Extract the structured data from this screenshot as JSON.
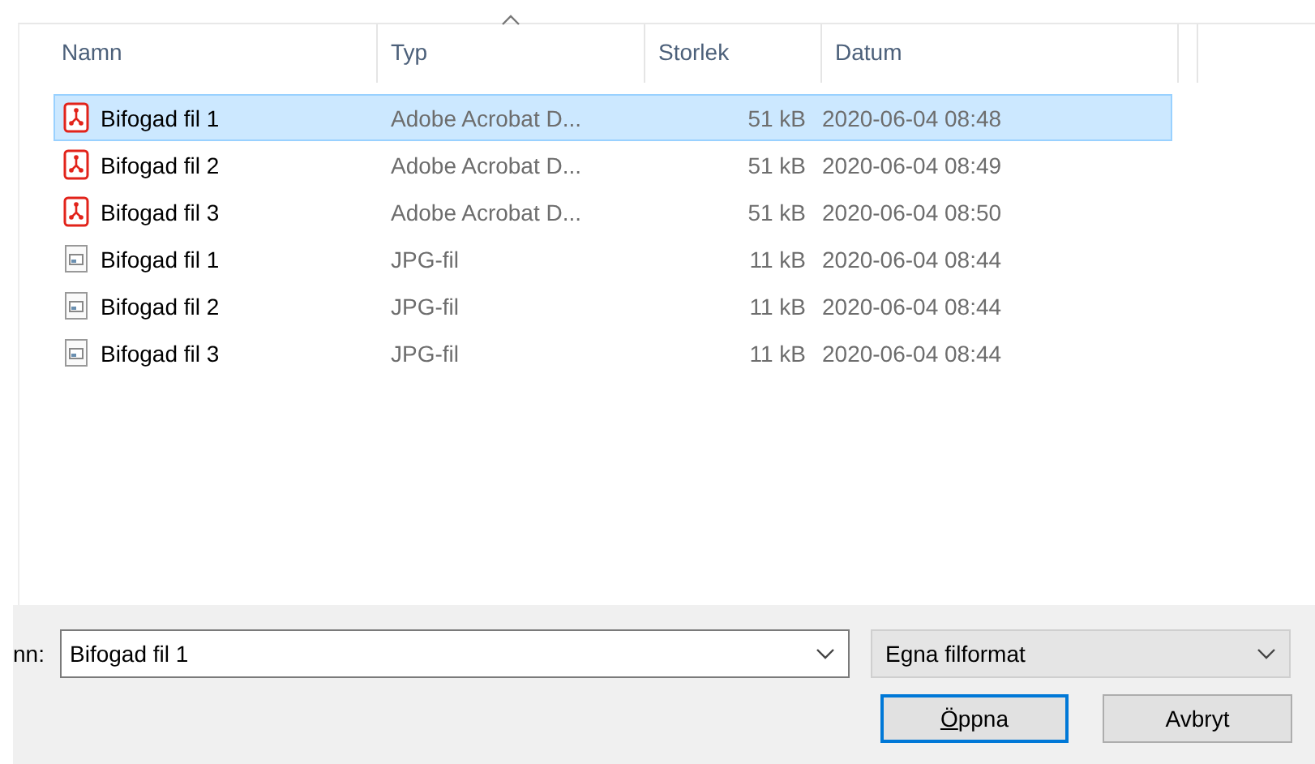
{
  "columns": [
    {
      "label": "Namn",
      "sorted": false
    },
    {
      "label": "Typ",
      "sorted": true
    },
    {
      "label": "Storlek",
      "sorted": false
    },
    {
      "label": "Datum",
      "sorted": false
    }
  ],
  "files": [
    {
      "kind": "pdf",
      "name": "Bifogad fil 1",
      "type": "Adobe Acrobat D...",
      "size": "51 kB",
      "date": "2020-06-04 08:48",
      "selected": true
    },
    {
      "kind": "pdf",
      "name": "Bifogad fil 2",
      "type": "Adobe Acrobat D...",
      "size": "51 kB",
      "date": "2020-06-04 08:49",
      "selected": false
    },
    {
      "kind": "pdf",
      "name": "Bifogad fil 3",
      "type": "Adobe Acrobat D...",
      "size": "51 kB",
      "date": "2020-06-04 08:50",
      "selected": false
    },
    {
      "kind": "image",
      "name": "Bifogad fil 1",
      "type": "JPG-fil",
      "size": "11 kB",
      "date": "2020-06-04 08:44",
      "selected": false
    },
    {
      "kind": "image",
      "name": "Bifogad fil 2",
      "type": "JPG-fil",
      "size": "11 kB",
      "date": "2020-06-04 08:44",
      "selected": false
    },
    {
      "kind": "image",
      "name": "Bifogad fil 3",
      "type": "JPG-fil",
      "size": "11 kB",
      "date": "2020-06-04 08:44",
      "selected": false
    }
  ],
  "footer": {
    "filename_label": "nn:",
    "filename_value": "Bifogad fil 1",
    "filter": "Egna filformat",
    "buttons": [
      {
        "label": "Öppna",
        "default": true
      },
      {
        "label": "Avbryt",
        "default": false
      }
    ]
  }
}
